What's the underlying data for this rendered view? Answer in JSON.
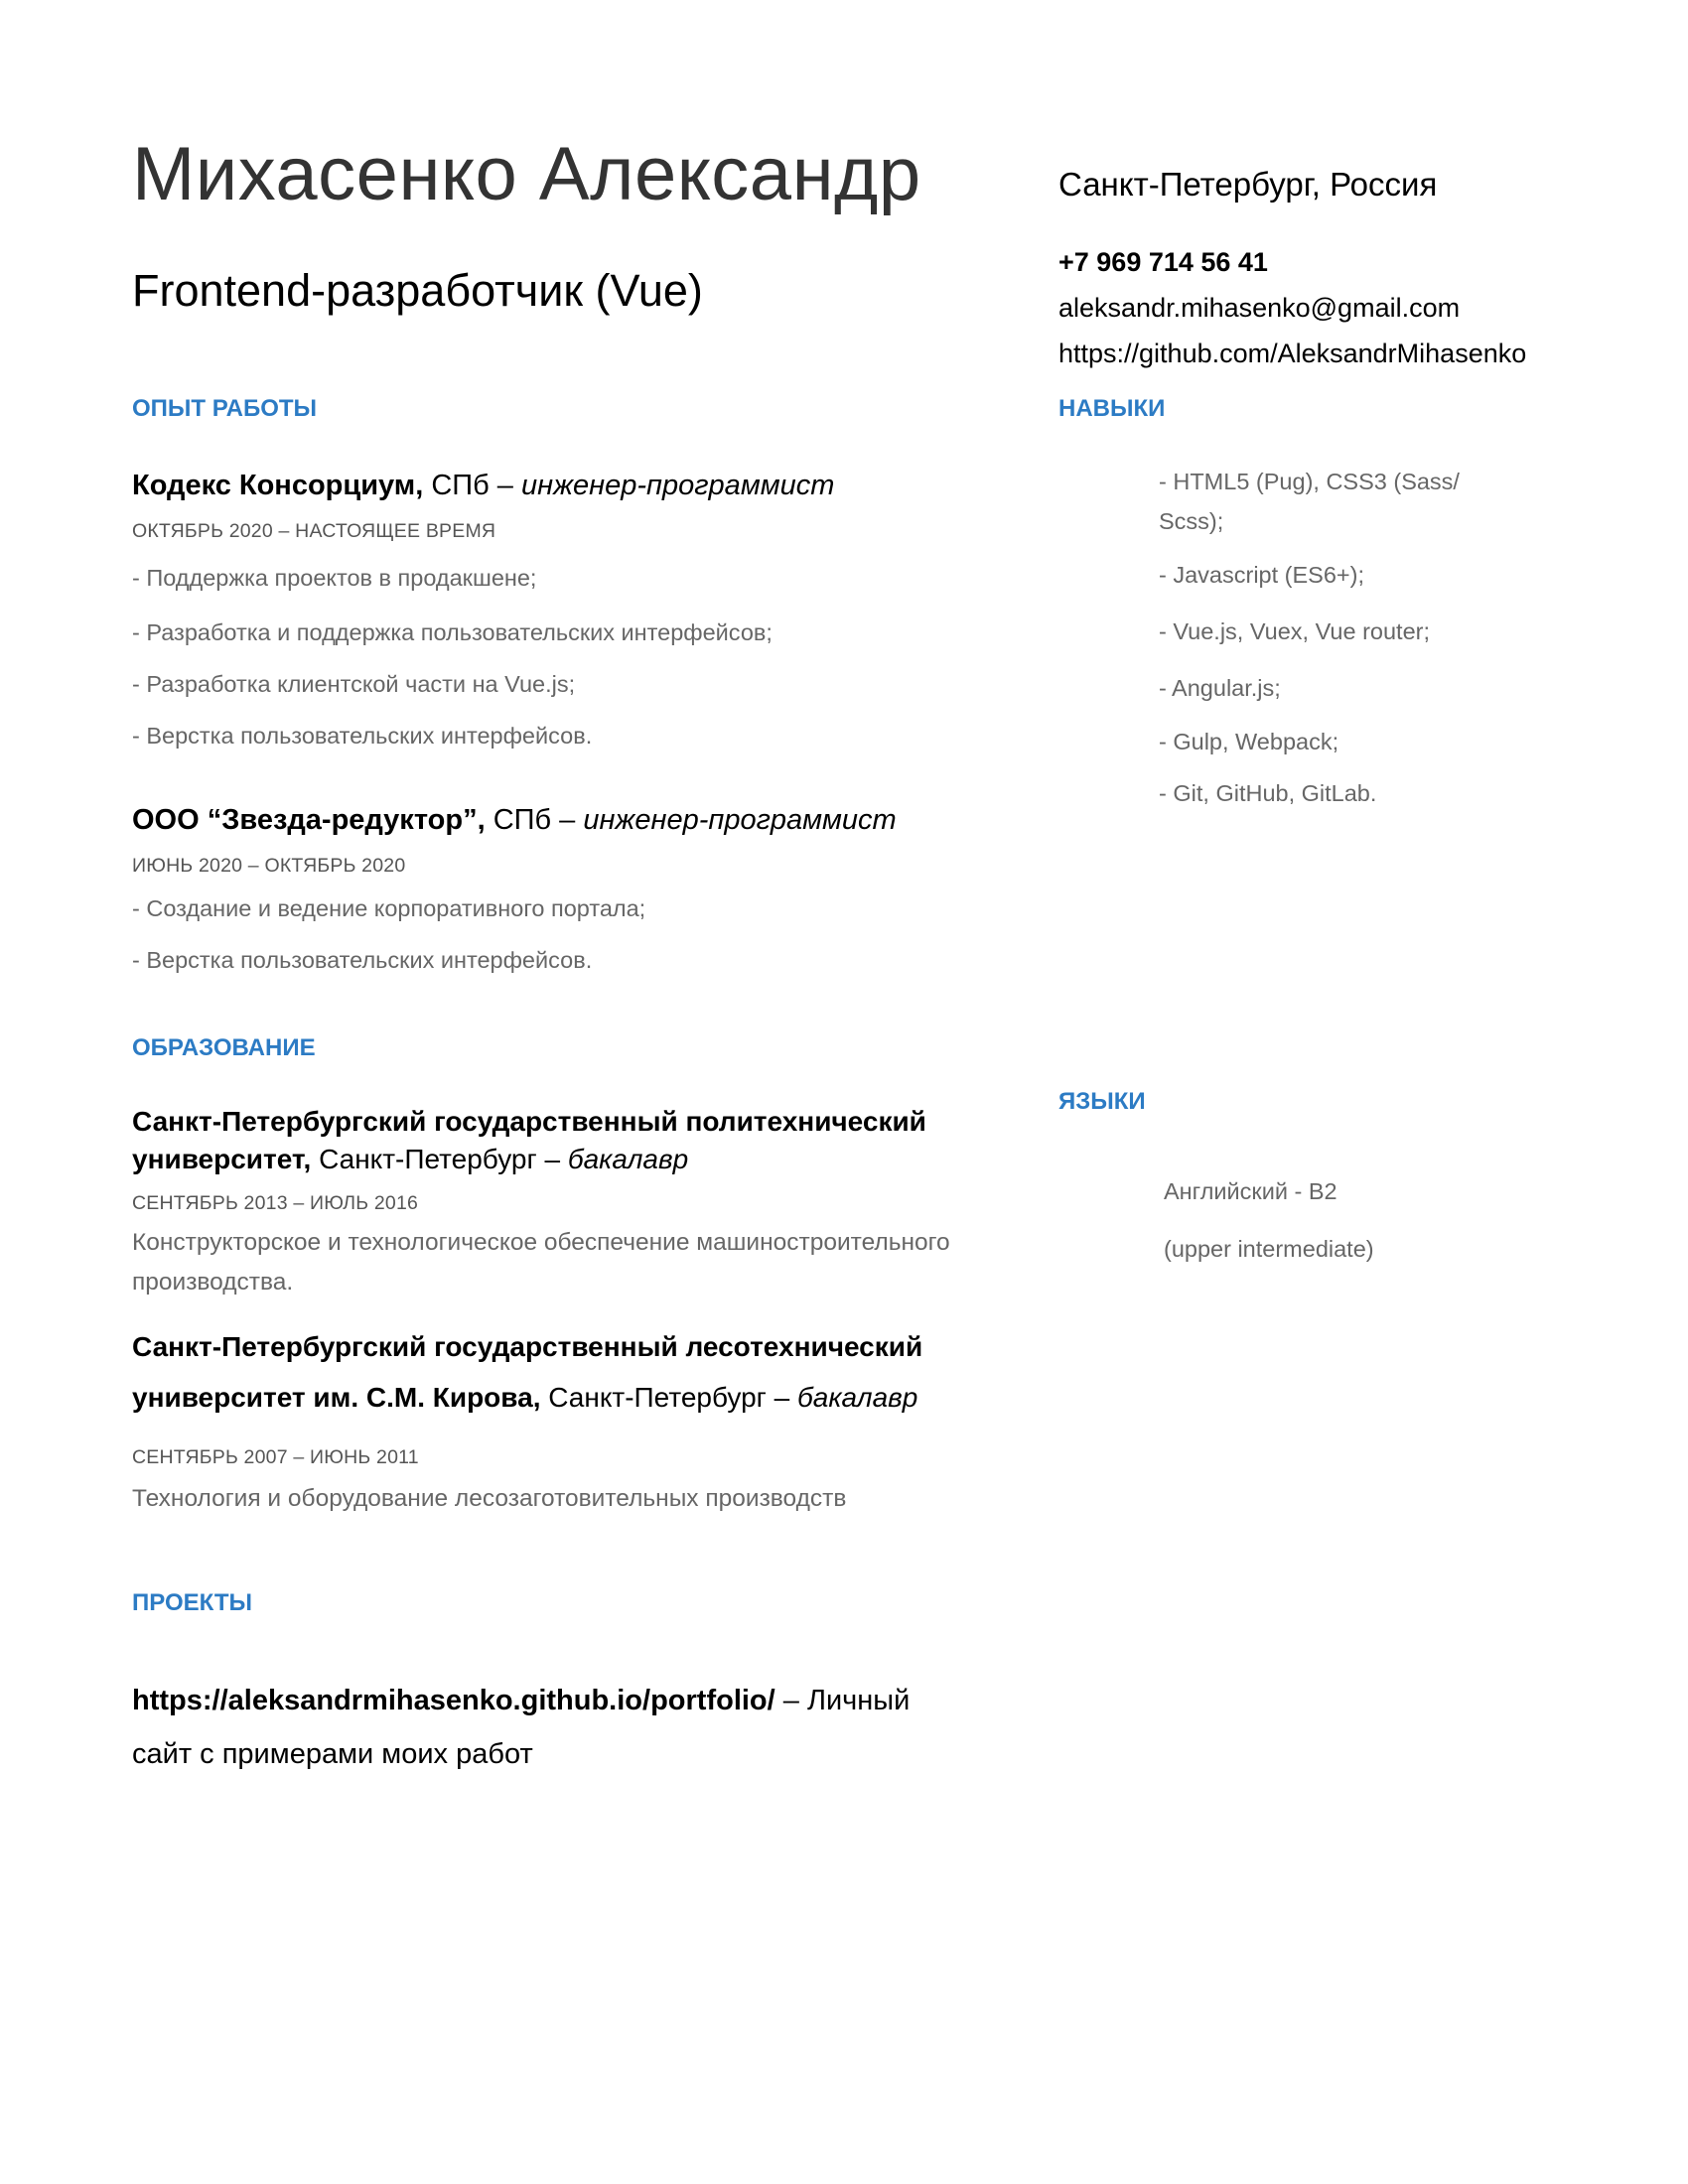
{
  "header": {
    "name": "Михасенко Александр",
    "role": "Frontend-разработчик (Vue)",
    "city": "Санкт-Петербург, Россия",
    "phone": "+7 969 714 56 41",
    "email": "aleksandr.mihasenko@gmail.com",
    "github": "https://github.com/AleksandrMihasenko"
  },
  "experience": {
    "heading": "ОПЫТ РАБОТЫ",
    "jobs": [
      {
        "company": "Кодекс Консорциум,",
        "location": " СПб – ",
        "position": "инженер-программист",
        "dates": "ОКТЯБРЬ 2020 – НАСТОЯЩЕЕ ВРЕМЯ",
        "duties": [
          "- Поддержка проектов в продакшене;",
          "- Разработка и поддержка пользовательских интерфейсов;",
          "- Разработка клиентской части на Vue.js;",
          "- Верстка пользовательских интерфейсов."
        ]
      },
      {
        "company": "ООО “Звезда-редуктор”,",
        "location": " СПб – ",
        "position": "инженер-программист",
        "dates": "ИЮНЬ 2020 – ОКТЯБРЬ 2020",
        "duties": [
          "- Создание и ведение корпоративного портала;",
          "- Верстка пользовательских интерфейсов."
        ]
      }
    ]
  },
  "education": {
    "heading": "ОБРАЗОВАНИЕ",
    "items": [
      {
        "title_line1": "Санкт-Петербургский государственный политехнический",
        "title_line2_bold": "университет,",
        "location": " Санкт-Петербург – ",
        "degree": "бакалавр",
        "dates": "СЕНТЯБРЬ 2013 – ИЮЛЬ 2016",
        "description": "Конструкторское и технологическое обеспечение машиностроительного производства."
      },
      {
        "title_line1": "Санкт-Петербургский государственный лесотехнический",
        "title_line2_bold": "университет им. С.М. Кирова,",
        "location": " Санкт-Петербург – ",
        "degree": "бакалавр",
        "dates": "СЕНТЯБРЬ 2007 – ИЮНЬ 2011",
        "description": "Технология и оборудование лесозаготовительных производств"
      }
    ]
  },
  "projects": {
    "heading": "ПРОЕКТЫ",
    "link": "https://aleksandrmihasenko.github.io/portfolio/",
    "description": " – Личный сайт с примерами моих работ"
  },
  "skills": {
    "heading": "НАВЫКИ",
    "items": [
      "- HTML5 (Pug), CSS3 (Sass/ Scss);",
      "- Javascript (ES6+);",
      "- Vue.js, Vuex, Vue router;",
      "- Angular.js;",
      "- Gulp, Webpack;",
      "- Git, GitHub, GitLab."
    ]
  },
  "languages": {
    "heading": "ЯЗЫКИ",
    "line1": "Английский - B2",
    "line2": "(upper intermediate)"
  }
}
